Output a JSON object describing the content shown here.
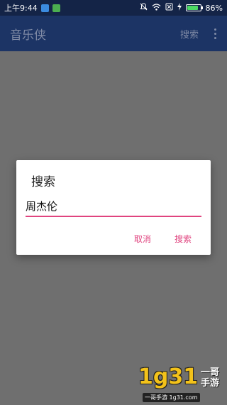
{
  "status_bar": {
    "time": "上午9:44",
    "battery_percent": "86%",
    "battery_level": 0.86
  },
  "app_bar": {
    "title": "音乐侠",
    "search_action": "搜索"
  },
  "dialog": {
    "title": "搜索",
    "input_value": "周杰伦",
    "cancel_label": "取消",
    "search_label": "搜索"
  },
  "watermark": {
    "digits": "1g31",
    "name": "一哥手游",
    "site": "一哥手游 1g31.com"
  },
  "colors": {
    "status_bar_bg": "#142447",
    "app_bar_bg": "#1c3465",
    "overlay": "#6f6f6f",
    "accent": "#e0447f"
  }
}
